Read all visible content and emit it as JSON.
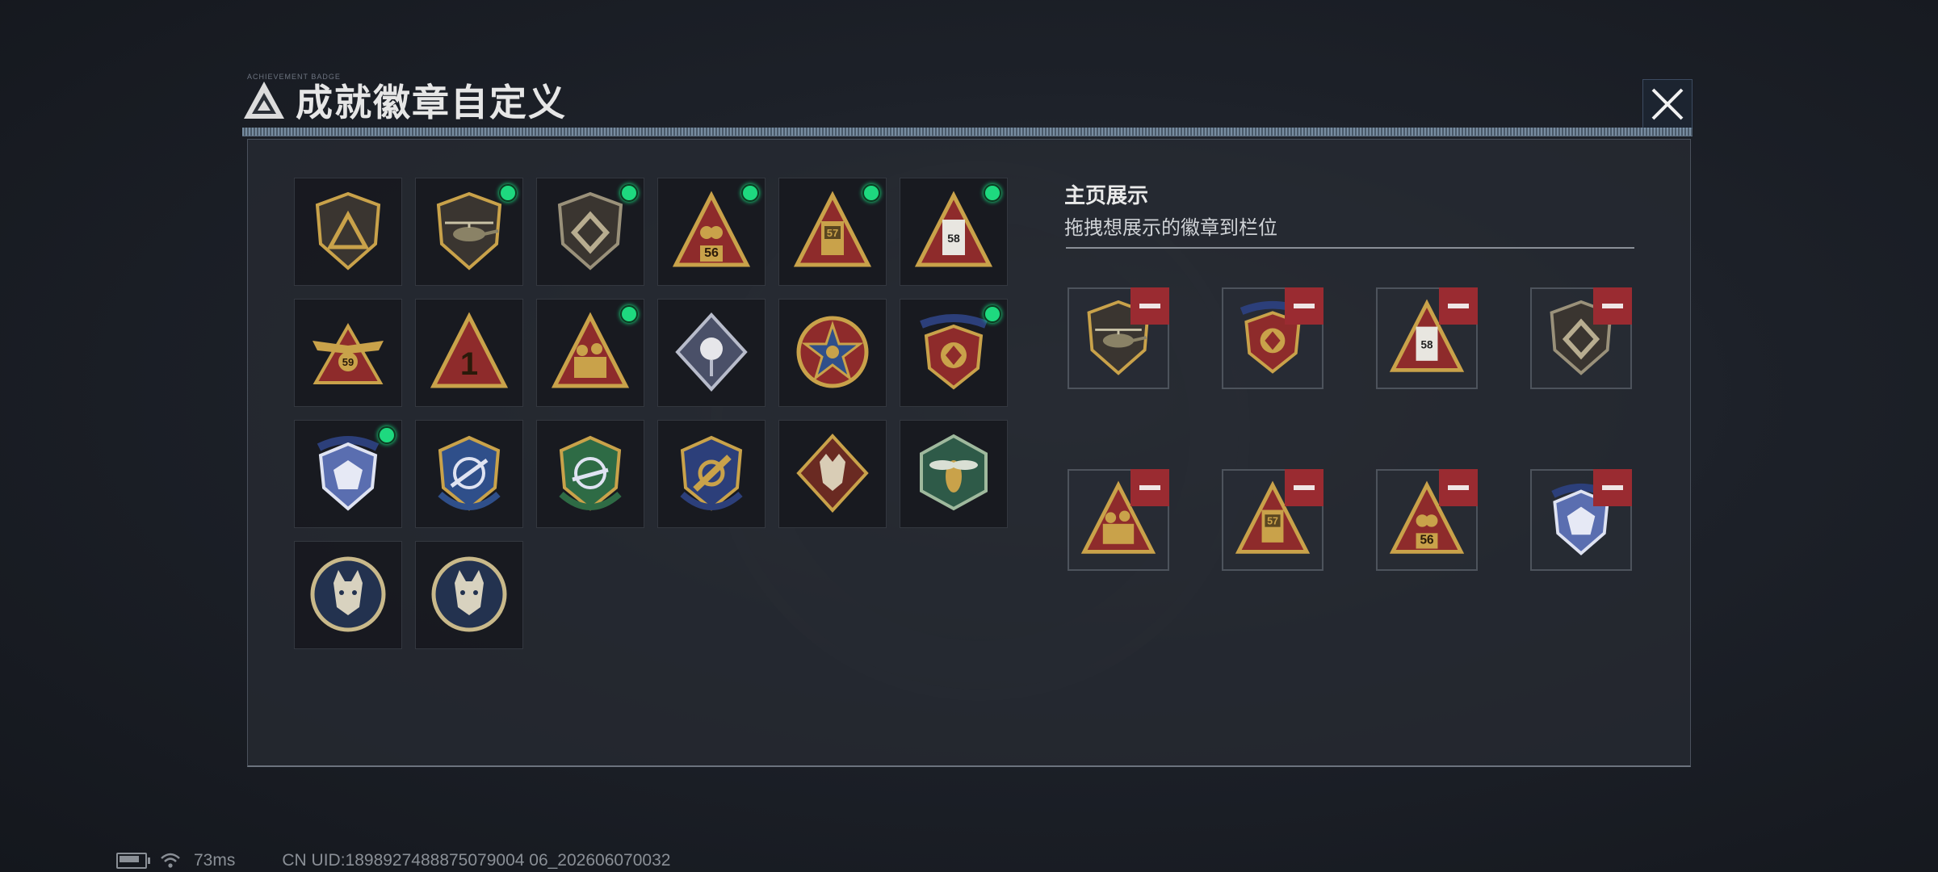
{
  "window": {
    "title": "成就徽章自定义",
    "subtitle_tiny": "ACHIEVEMENT BADGE"
  },
  "badges": [
    {
      "icon": "shield-logo-badge",
      "selected": false
    },
    {
      "icon": "helicopter-shield-badge",
      "selected": true
    },
    {
      "icon": "diamond-shield-badge",
      "selected": true
    },
    {
      "icon": "triangle-56-badge",
      "selected": true,
      "label": "56"
    },
    {
      "icon": "triangle-57-badge",
      "selected": true,
      "label": "57"
    },
    {
      "icon": "triangle-58-badge",
      "selected": true,
      "label": "58"
    },
    {
      "icon": "winged-59-badge",
      "selected": false,
      "label": "59"
    },
    {
      "icon": "triangle-number-1-badge",
      "selected": false,
      "label": "1"
    },
    {
      "icon": "soldiers-triangle-badge",
      "selected": true
    },
    {
      "icon": "rose-diamond-badge",
      "selected": false
    },
    {
      "icon": "star-medal-badge",
      "selected": false
    },
    {
      "icon": "star-crest-badge",
      "selected": true
    },
    {
      "icon": "blue-gem-crest-badge",
      "selected": true
    },
    {
      "icon": "blue-crosshair-crest-badge",
      "selected": false
    },
    {
      "icon": "green-crosshair-crest-badge",
      "selected": false
    },
    {
      "icon": "gold-crossed-crest-badge",
      "selected": false
    },
    {
      "icon": "wolf-diamond-badge",
      "selected": false
    },
    {
      "icon": "hornet-hexagon-badge",
      "selected": false
    },
    {
      "icon": "lynx-round-badge",
      "selected": false
    },
    {
      "icon": "lynx-round-badge-2",
      "selected": false
    }
  ],
  "showcase": {
    "title": "主页展示",
    "subtitle": "拖拽想展示的徽章到栏位",
    "slots": [
      {
        "icon": "helicopter-shield-badge"
      },
      {
        "icon": "star-crest-badge"
      },
      {
        "icon": "triangle-58-badge",
        "label": "58"
      },
      {
        "icon": "diamond-shield-badge"
      },
      {
        "icon": "soldiers-triangle-badge"
      },
      {
        "icon": "triangle-57-badge",
        "label": "57"
      },
      {
        "icon": "triangle-56-badge",
        "label": "56"
      },
      {
        "icon": "blue-gem-crest-badge"
      }
    ]
  },
  "status": {
    "ping": "73ms",
    "uid": "CN UID:1898927488875079004 06_202606070032"
  },
  "colors": {
    "selected_dot": "#1ed97f",
    "remove_button": "#9a2b31",
    "badge_gold": "#c9a24a",
    "badge_red": "#8e2b2b",
    "badge_blue": "#2f4f8a",
    "badge_green": "#2e6b45"
  }
}
